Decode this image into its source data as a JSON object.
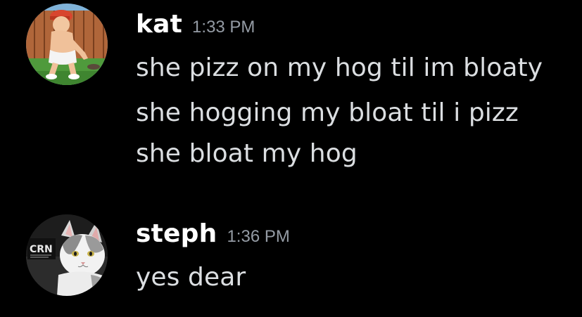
{
  "messages": [
    {
      "author": "kat",
      "timestamp": "1:33 PM",
      "avatar": "cartoon-boy-avatar",
      "lines": [
        "she pizz on my hog til im bloaty",
        "she hogging my bloat til i pizz",
        "she bloat my hog"
      ]
    },
    {
      "author": "steph",
      "timestamp": "1:36 PM",
      "avatar": "cat-photo-avatar",
      "lines": [
        "yes dear"
      ]
    }
  ],
  "avatar_badge_text": "CRN",
  "colors": {
    "background": "#000000",
    "username": "#ffffff",
    "message_text": "#dbdee1",
    "timestamp": "#949ba4"
  }
}
